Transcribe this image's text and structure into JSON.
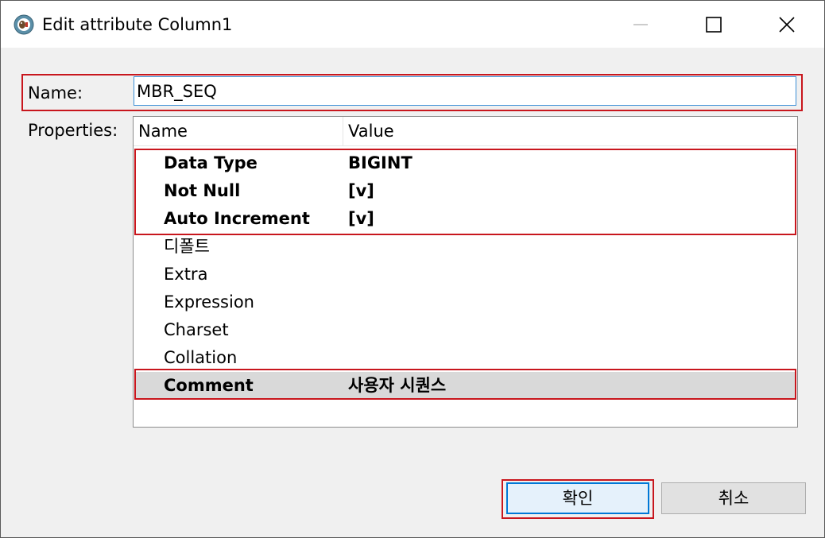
{
  "window": {
    "title": "Edit attribute Column1"
  },
  "form": {
    "name_label": "Name:",
    "name_value": "MBR_SEQ",
    "properties_label": "Properties:"
  },
  "table": {
    "headers": [
      "Name",
      "Value"
    ],
    "rows": [
      {
        "name": "Data Type",
        "value": "BIGINT",
        "bold": true
      },
      {
        "name": "Not Null",
        "value": "[v]",
        "bold": true
      },
      {
        "name": "Auto Increment",
        "value": "[v]",
        "bold": true
      },
      {
        "name": "디폴트",
        "value": "",
        "bold": false
      },
      {
        "name": "Extra",
        "value": "",
        "bold": false
      },
      {
        "name": "Expression",
        "value": "",
        "bold": false
      },
      {
        "name": "Charset",
        "value": "",
        "bold": false
      },
      {
        "name": "Collation",
        "value": "",
        "bold": false
      },
      {
        "name": "Comment",
        "value": "사용자 시퀀스",
        "bold": true,
        "selected": true
      }
    ]
  },
  "buttons": {
    "ok_label": "확인",
    "cancel_label": "취소"
  },
  "colors": {
    "highlight": "#c8161d",
    "focus_border": "#0078d7",
    "selected_row": "#d9d9d9"
  },
  "icons": {
    "app": "dbeaver-beaver-icon",
    "minimize": "minimize-icon",
    "maximize": "maximize-icon",
    "close": "close-icon"
  }
}
